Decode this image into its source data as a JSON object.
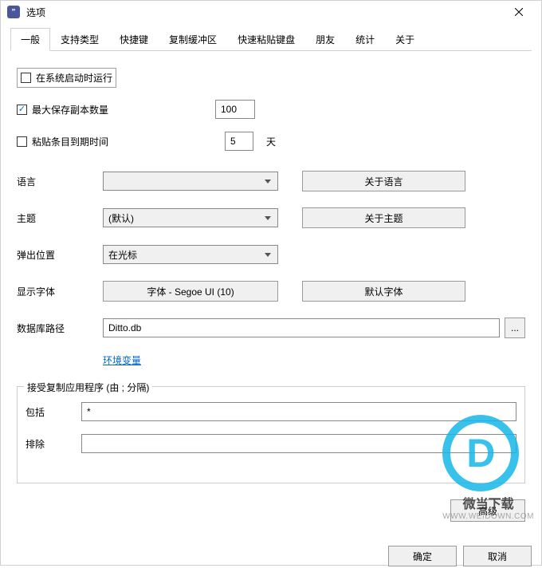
{
  "window": {
    "title": "选项"
  },
  "tabs": [
    "一般",
    "支持类型",
    "快捷键",
    "复制缓冲区",
    "快速粘贴键盘",
    "朋友",
    "统计",
    "关于"
  ],
  "active_tab": 0,
  "general": {
    "run_on_startup": {
      "label": "在系统启动时运行",
      "checked": false
    },
    "max_copies": {
      "label": "最大保存副本数量",
      "checked": true,
      "value": "100"
    },
    "expire": {
      "label": "粘贴条目到期时间",
      "checked": false,
      "value": "5",
      "unit": "天"
    },
    "language": {
      "label": "语言",
      "value": "",
      "about_btn": "关于语言"
    },
    "theme": {
      "label": "主题",
      "value": "(默认)",
      "about_btn": "关于主题"
    },
    "popup_pos": {
      "label": "弹出位置",
      "value": "在光标"
    },
    "font": {
      "label": "显示字体",
      "btn": "字体 - Segoe UI (10)",
      "default_btn": "默认字体"
    },
    "db_path": {
      "label": "数据库路径",
      "value": "Ditto.db",
      "env_link": "环境变量",
      "browse": "..."
    },
    "copy_apps": {
      "legend": "接受复制应用程序 (由 ; 分隔)",
      "include_label": "包括",
      "include_value": "*",
      "exclude_label": "排除",
      "exclude_value": ""
    },
    "advanced_btn": "高级"
  },
  "footer": {
    "ok": "确定",
    "cancel": "取消"
  },
  "watermark": {
    "line1": "微当下载",
    "line2": "WWW.WEIDOWN.COM"
  }
}
